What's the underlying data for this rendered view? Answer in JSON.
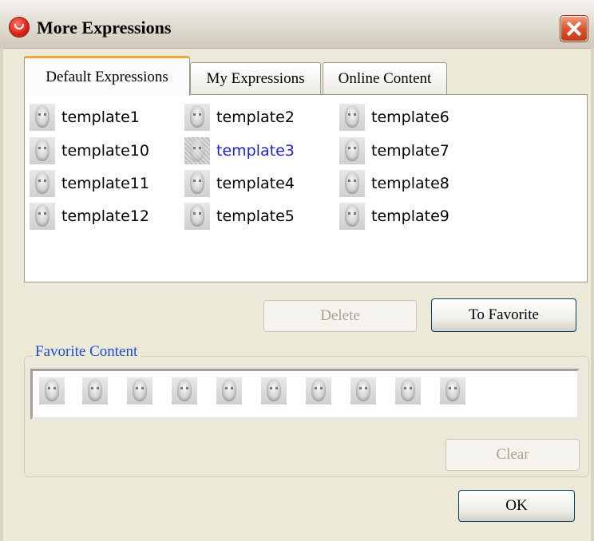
{
  "window": {
    "title": "More Expressions"
  },
  "tabs": [
    {
      "label": "Default Expressions",
      "active": true
    },
    {
      "label": "My Expressions",
      "active": false
    },
    {
      "label": "Online Content",
      "active": false
    }
  ],
  "templates": [
    [
      "template1",
      "template10",
      "template11",
      "template12"
    ],
    [
      "template2",
      "template3",
      "template4",
      "template5"
    ],
    [
      "template6",
      "template7",
      "template8",
      "template9"
    ]
  ],
  "selected_template": "template3",
  "buttons": {
    "delete": "Delete",
    "to_favorite": "To Favorite",
    "clear": "Clear",
    "ok": "OK"
  },
  "favorite": {
    "legend": "Favorite Content",
    "count": 10,
    "icon": "face-thumbnail-icon"
  },
  "colors": {
    "selected_text": "#2222cc",
    "legend_text": "#1c4cd1",
    "active_tab_accent": "#f0a53a"
  }
}
